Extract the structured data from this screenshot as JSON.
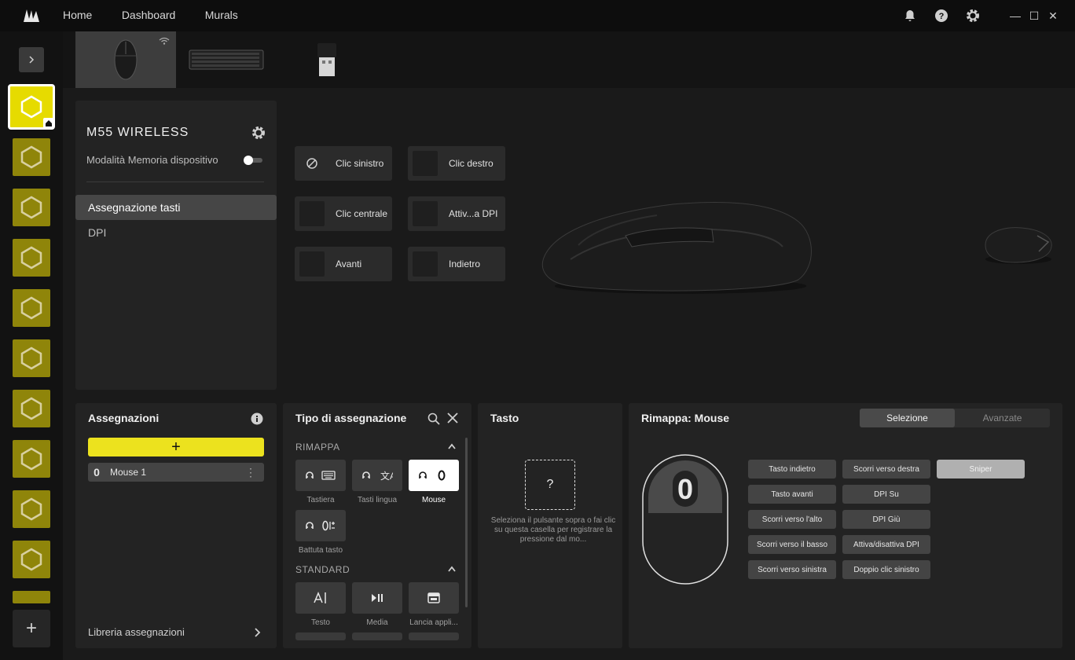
{
  "nav": {
    "home": "Home",
    "dashboard": "Dashboard",
    "murals": "Murals"
  },
  "window": {
    "minimize": "—",
    "maximize": "☐",
    "close": "✕"
  },
  "device": {
    "name": "M55 WIRELESS",
    "memory_mode_label": "Modalità Memoria dispositivo",
    "memory_mode_on": false,
    "menu": {
      "selected": "Assegnazione tasti",
      "other": "DPI"
    }
  },
  "keys": {
    "left": "Clic sinistro",
    "right": "Clic destro",
    "middle": "Clic centrale",
    "dpi": "Attiv...a DPI",
    "forward": "Avanti",
    "back": "Indietro"
  },
  "assignments": {
    "title": "Assegnazioni",
    "add": "+",
    "item_icon": "0",
    "item": "Mouse 1",
    "library": "Libreria assegnazioni"
  },
  "assign_type": {
    "title": "Tipo di assegnazione",
    "section1": "RIMAPPA",
    "section2": "STANDARD",
    "tiles": {
      "keyboard": "Tastiera",
      "language": "Tasti lingua",
      "mouse": "Mouse",
      "keystroke": "Battuta tasto",
      "text": "Testo",
      "media": "Media",
      "launch": "Lancia appli..."
    }
  },
  "key_panel": {
    "title": "Tasto",
    "box": "?",
    "hint": "Seleziona il pulsante sopra o fai clic su questa casella per registrare la pressione dal mo..."
  },
  "remap": {
    "title": "Rimappa: Mouse",
    "tab_select": "Selezione",
    "tab_advanced": "Avanzate",
    "mouse_icon_text": "0",
    "col1": [
      "Tasto indietro",
      "Tasto avanti",
      "Scorri verso l'alto",
      "Scorri verso il basso",
      "Scorri verso sinistra"
    ],
    "col2": [
      "Scorri verso destra",
      "DPI Su",
      "DPI Giù",
      "Attiva/disattiva DPI",
      "Doppio clic sinistro"
    ],
    "col3": [
      "Sniper"
    ]
  },
  "colors": {
    "accent": "#ece21e",
    "profile": "#8f850a"
  }
}
